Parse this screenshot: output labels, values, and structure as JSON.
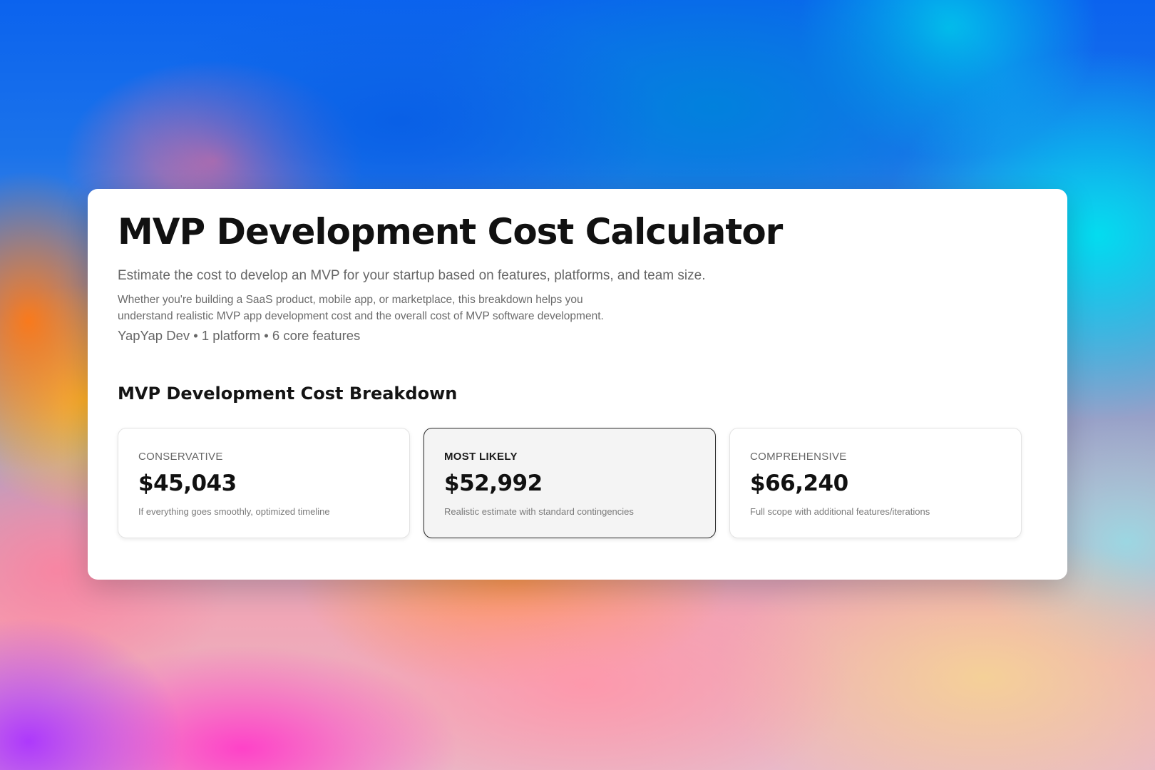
{
  "header": {
    "title": "MVP Development Cost Calculator",
    "subtitle": "Estimate the cost to develop an MVP for your startup based on features, platforms, and team size.",
    "description": "Whether you're building a SaaS product, mobile app, or marketplace, this breakdown helps you understand realistic MVP app development cost and the overall cost of MVP software development.",
    "meta": "YapYap Dev • 1 platform • 6 core features"
  },
  "breakdown": {
    "heading": "MVP Development Cost Breakdown",
    "estimates": [
      {
        "label": "CONSERVATIVE",
        "value": "$45,043",
        "note": "If everything goes smoothly, optimized timeline"
      },
      {
        "label": "MOST LIKELY",
        "value": "$52,992",
        "note": "Realistic estimate with standard contingencies"
      },
      {
        "label": "COMPREHENSIVE",
        "value": "$66,240",
        "note": "Full scope with additional features/iterations"
      }
    ]
  }
}
